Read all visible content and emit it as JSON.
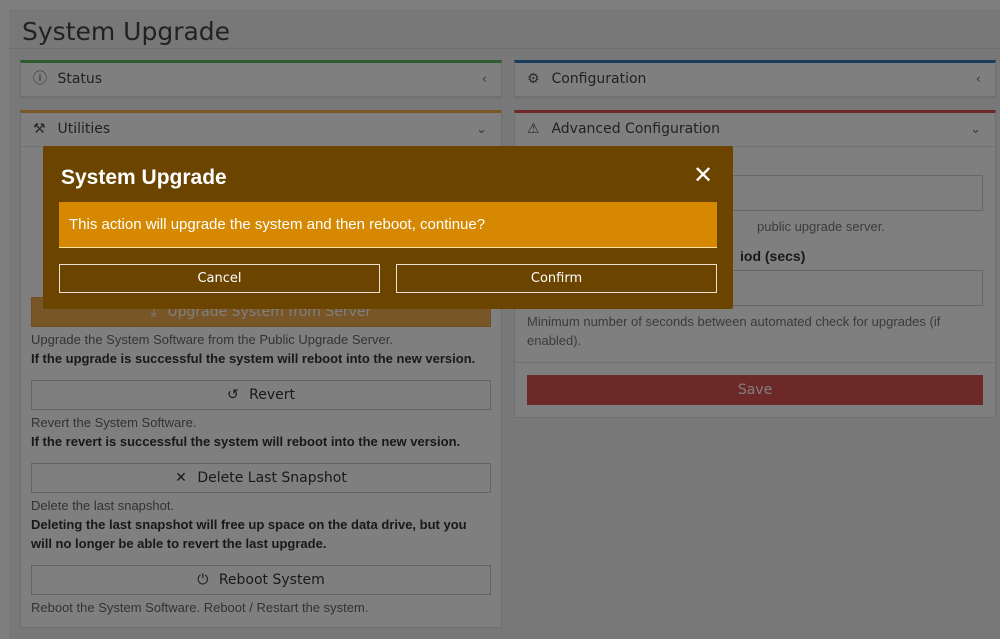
{
  "page": {
    "title": "System Upgrade"
  },
  "panels": {
    "status": {
      "label": "Status",
      "chevron": "‹"
    },
    "configuration": {
      "label": "Configuration",
      "chevron": "‹"
    },
    "utilities": {
      "label": "Utilities",
      "chevron": "⌄"
    },
    "advanced": {
      "label": "Advanced Configuration",
      "chevron": "⌄"
    }
  },
  "utilities": {
    "upgrade_server_label": "Upgrade System from Server",
    "upgrade_server_desc": "Upgrade the System Software from the Public Upgrade Server.",
    "upgrade_server_note": "If the upgrade is successful the system will reboot into the new version.",
    "revert_label": "Revert",
    "revert_desc": "Revert the System Software.",
    "revert_note": "If the revert is successful the system will reboot into the new version.",
    "delete_label": "Delete Last Snapshot",
    "delete_desc": "Delete the last snapshot.",
    "delete_note": "Deleting the last snapshot will free up space on the data drive, but you will no longer be able to revert the last upgrade.",
    "reboot_label": "Reboot System",
    "reboot_desc": "Reboot the System Software. Reboot / Restart the system."
  },
  "advanced": {
    "server_help": "public upgrade server.",
    "period_label": "iod (secs)",
    "period_help": "Minimum number of seconds between automated check for upgrades (if enabled).",
    "save_label": "Save"
  },
  "modal": {
    "title": "System Upgrade",
    "message": "This action will upgrade the system and then reboot, continue?",
    "cancel_label": "Cancel",
    "confirm_label": "Confirm",
    "close_glyph": "✕"
  }
}
